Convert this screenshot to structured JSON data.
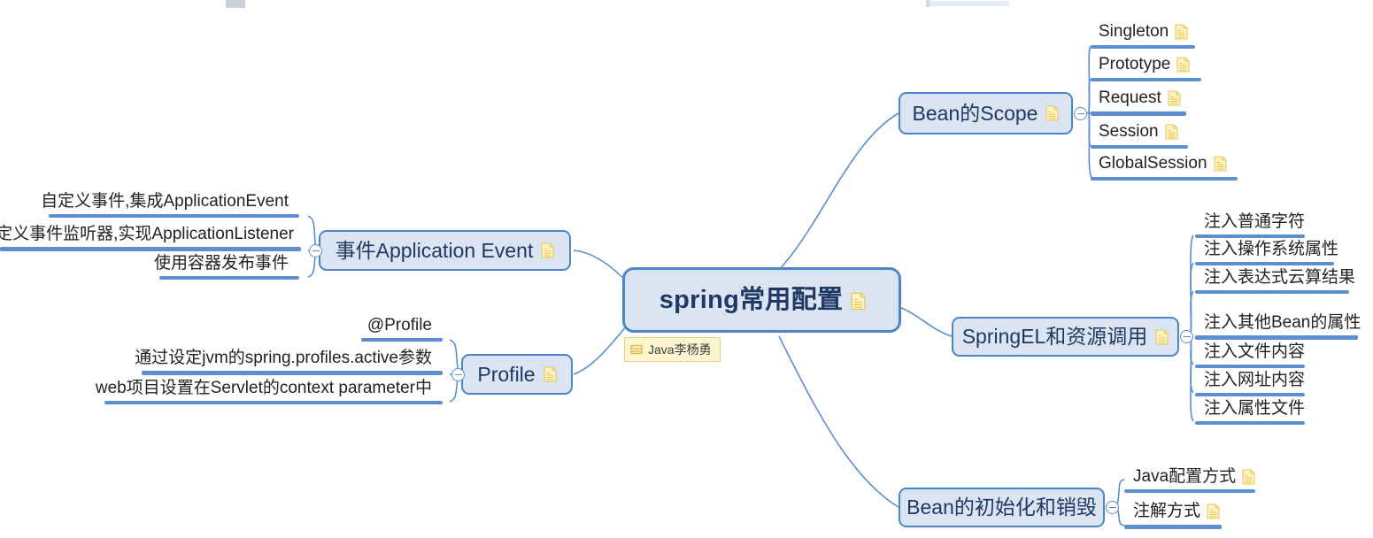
{
  "map": {
    "root": {
      "label": "spring常用配置",
      "has_note": true,
      "badge": {
        "text": "Java李杨勇",
        "icon": "table-icon"
      }
    },
    "branches": [
      {
        "id": "bean-scope",
        "label": "Bean的Scope",
        "has_note": true,
        "side": "right",
        "collapsed": false,
        "children": [
          {
            "label": "Singleton",
            "has_note": true
          },
          {
            "label": "Prototype",
            "has_note": true
          },
          {
            "label": "Request",
            "has_note": true
          },
          {
            "label": "Session",
            "has_note": true
          },
          {
            "label": "GlobalSession",
            "has_note": true
          }
        ]
      },
      {
        "id": "springel",
        "label": "SpringEL和资源调用",
        "has_note": true,
        "side": "right",
        "collapsed": false,
        "children": [
          {
            "label": "注入普通字符",
            "has_note": false
          },
          {
            "label": "注入操作系统属性",
            "has_note": false
          },
          {
            "label": "注入表达式云算结果",
            "has_note": false
          },
          {
            "label": "注入其他Bean的属性",
            "has_note": false
          },
          {
            "label": "注入文件内容",
            "has_note": false
          },
          {
            "label": "注入网址内容",
            "has_note": false
          },
          {
            "label": "注入属性文件",
            "has_note": false
          }
        ]
      },
      {
        "id": "bean-init-destroy",
        "label": "Bean的初始化和销毁",
        "has_note": false,
        "side": "right",
        "collapsed": false,
        "children": [
          {
            "label": "Java配置方式",
            "has_note": true
          },
          {
            "label": "注解方式",
            "has_note": true
          }
        ]
      },
      {
        "id": "application-event",
        "label": "事件Application Event",
        "has_note": true,
        "side": "left",
        "collapsed": false,
        "children": [
          {
            "label": "自定义事件,集成ApplicationEvent",
            "has_note": false
          },
          {
            "label": "定义事件监听器,实现ApplicationListener",
            "has_note": false
          },
          {
            "label": "使用容器发布事件",
            "has_note": false
          }
        ]
      },
      {
        "id": "profile",
        "label": "Profile",
        "has_note": true,
        "side": "left",
        "collapsed": false,
        "children": [
          {
            "label": "@Profile",
            "has_note": false
          },
          {
            "label": "通过设定jvm的spring.profiles.active参数",
            "has_note": false
          },
          {
            "label": "web项目设置在Servlet的context parameter中",
            "has_note": false
          }
        ]
      }
    ],
    "colors": {
      "node_fill": "#dbe4f2",
      "node_border": "#4a86c8",
      "line": "#5b8fd0",
      "text": "#1f3864",
      "leaf_text": "#222222",
      "note_icon": "#f7e08a",
      "badge_fill": "#fdf5cf",
      "background": "#ffffff"
    }
  }
}
